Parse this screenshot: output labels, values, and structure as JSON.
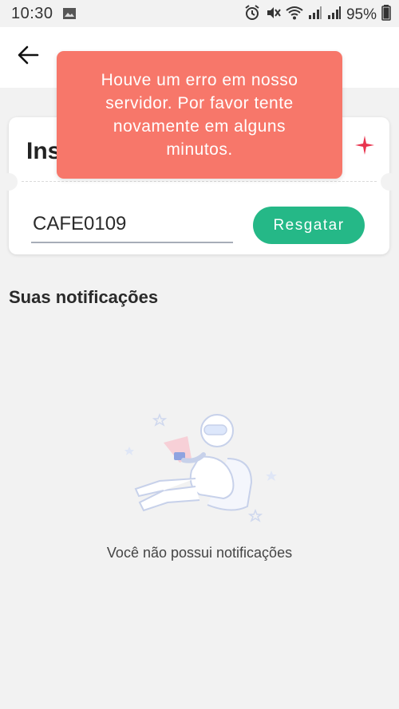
{
  "status_bar": {
    "time": "10:30",
    "battery": "95%"
  },
  "header": {
    "back_icon": "arrow-left-icon"
  },
  "code_card": {
    "title": "Ins",
    "input_value": "CAFE0109",
    "redeem_label": "Resgatar",
    "accent_color": "#e8344e"
  },
  "toast": {
    "message": "Houve um erro em nosso servidor. Por favor tente novamente em alguns minutos."
  },
  "notifications": {
    "section_title": "Suas notificações",
    "empty_message": "Você não possui notificações"
  },
  "colors": {
    "primary_green": "#25b887",
    "toast_red": "#f7776a",
    "background": "#f2f2f2"
  }
}
